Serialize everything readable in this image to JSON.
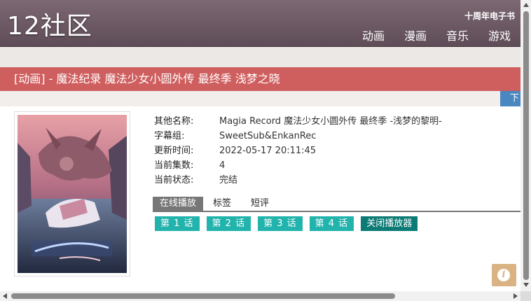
{
  "header": {
    "logo": "12社区",
    "top_link": "十周年电子书",
    "nav": [
      "动画",
      "漫画",
      "音乐",
      "游戏"
    ]
  },
  "title_bar": "[动画] - 魔法纪录 魔法少女小圆外传 最终季 浅梦之晓",
  "download_tab": "下",
  "details": [
    {
      "label": "其他名称:",
      "value": "Magia Record 魔法少女小圆外传 最终季 -浅梦的黎明-"
    },
    {
      "label": "字幕组:",
      "value": "SweetSub&EnkanRec"
    },
    {
      "label": "更新时间:",
      "value": "2022-05-17 20:11:45"
    },
    {
      "label": "当前集数:",
      "value": "4"
    },
    {
      "label": "当前状态:",
      "value": "完结"
    }
  ],
  "tabs": [
    "在线播放",
    "标签",
    "短评"
  ],
  "episodes": [
    "第 1 话",
    "第 2 话",
    "第 3 话",
    "第 4 话"
  ],
  "close_player": "关闭播放器",
  "info_icon": "i",
  "colors": {
    "header": "#6b5862",
    "title_bar": "#cf5e5e",
    "episode_button": "#22b3ac",
    "close_button": "#0d7b75",
    "download_tab": "#4a87c1"
  }
}
